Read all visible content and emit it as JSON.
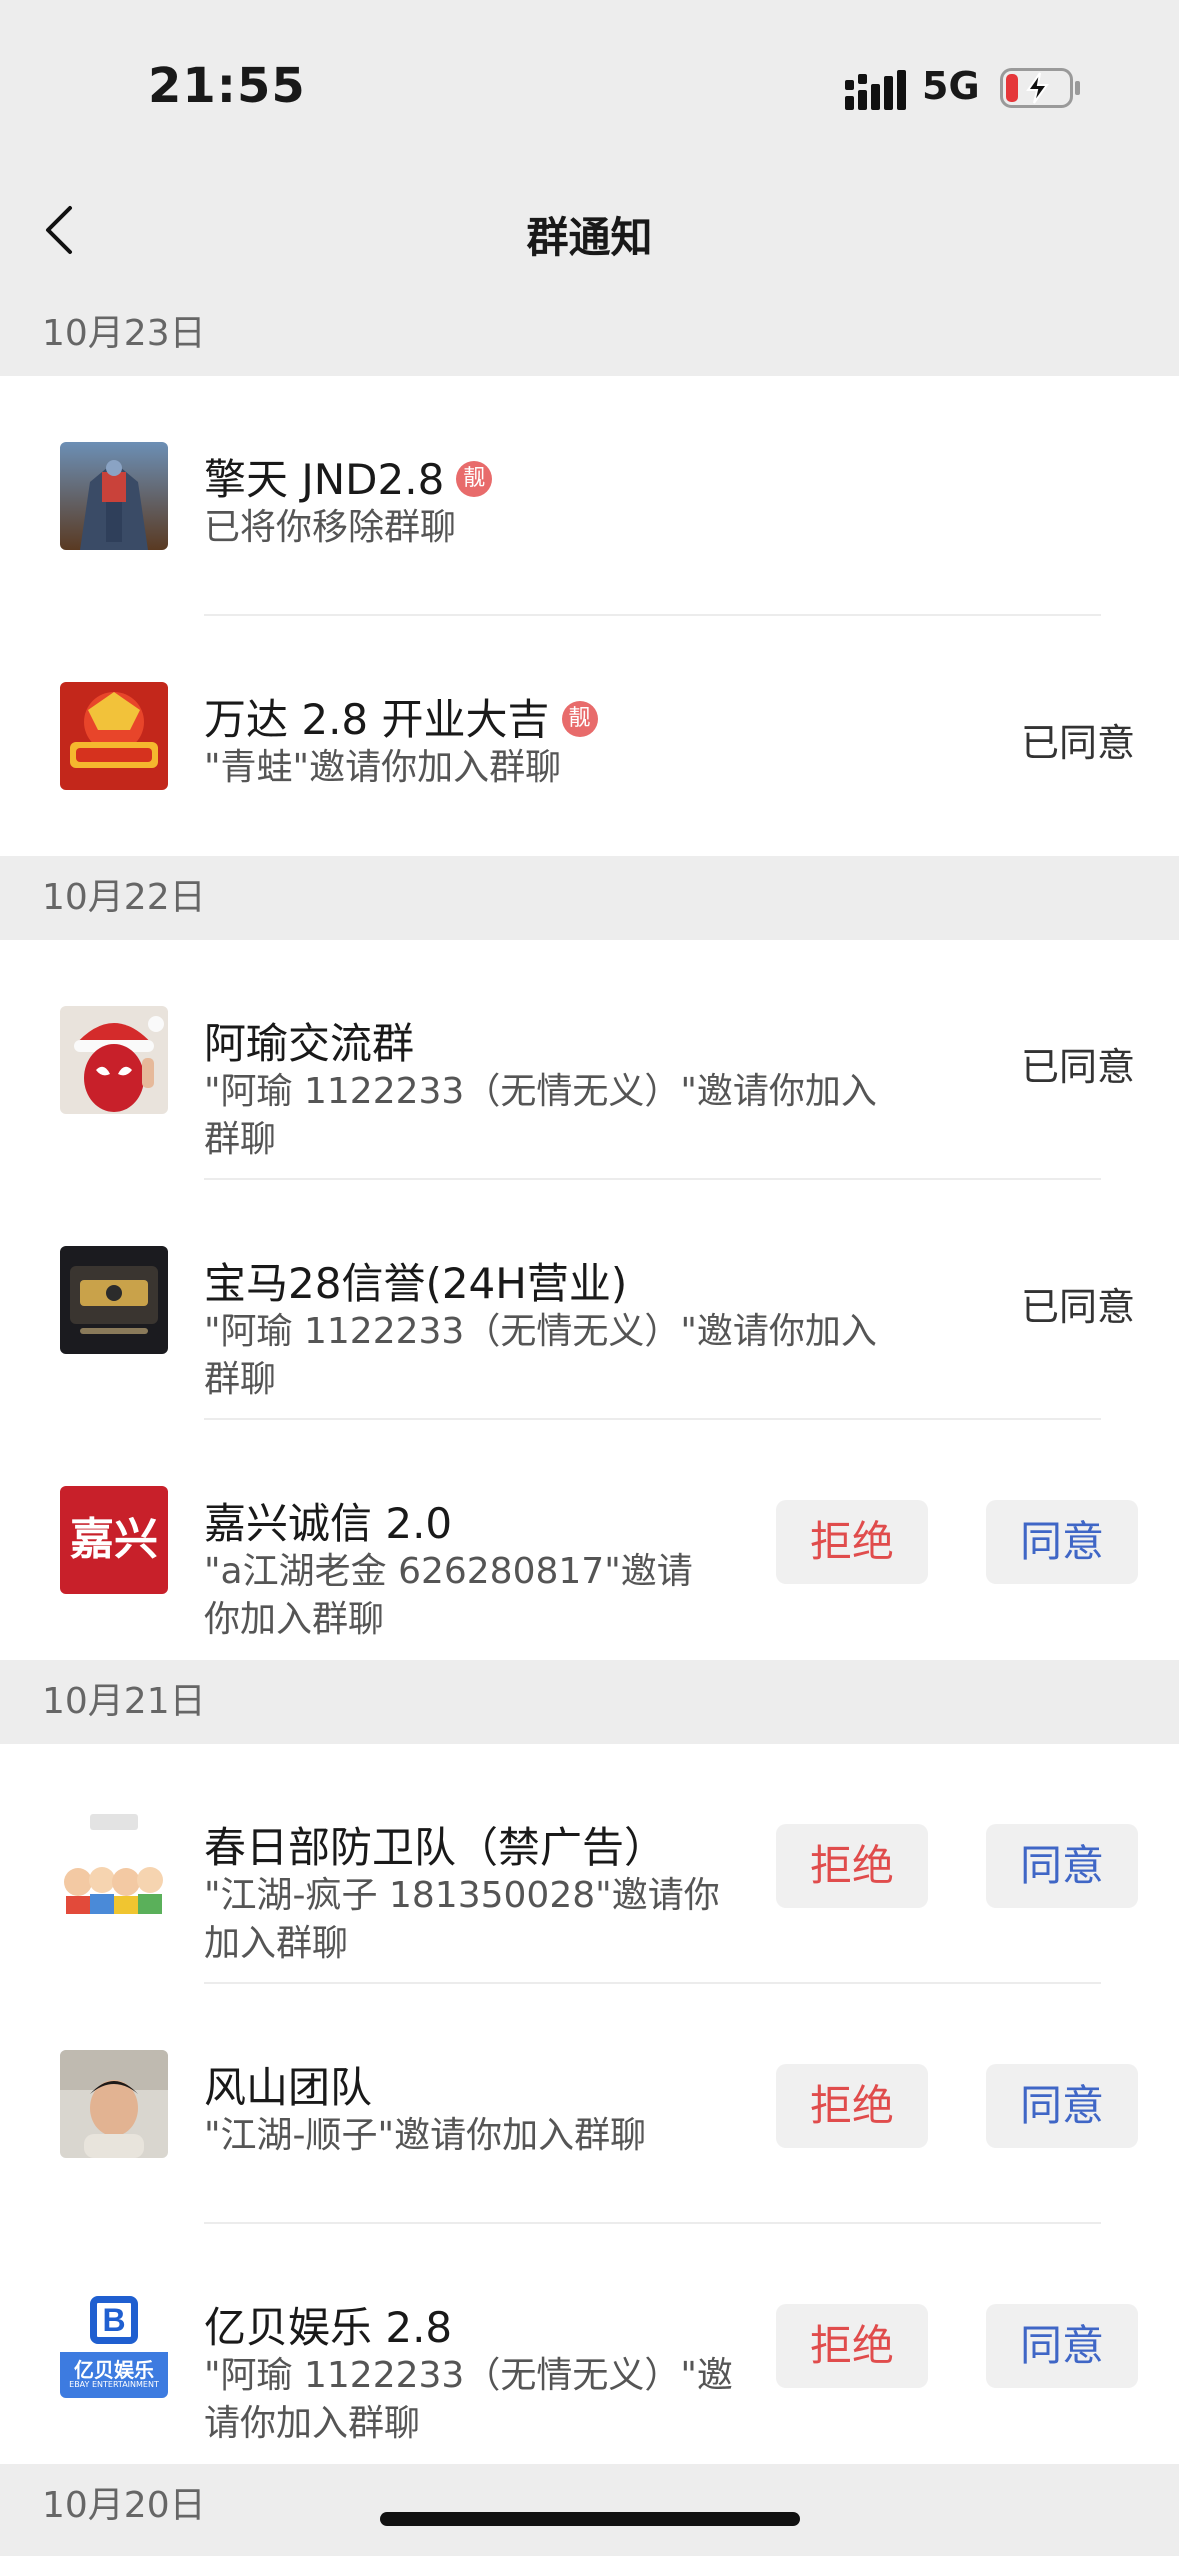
{
  "status_bar": {
    "time": "21:55",
    "network": "5G"
  },
  "nav": {
    "title": "群通知"
  },
  "sections": [
    {
      "date": "10月23日"
    },
    {
      "date": "10月22日"
    },
    {
      "date": "10月21日"
    },
    {
      "date": "10月20日"
    }
  ],
  "items": [
    {
      "name": "擎天 JND2.8",
      "badge": "靓",
      "message": "已将你移除群聊"
    },
    {
      "name": "万达 2.8 开业大吉",
      "badge": "靓",
      "message": "\"青蛙\"邀请你加入群聊",
      "status": "已同意"
    },
    {
      "name": "阿瑜交流群",
      "message_line1": "\"阿瑜 1122233（无情无义）\"邀请你加入",
      "message_line2": "群聊",
      "status": "已同意"
    },
    {
      "name": "宝马28信誉(24H营业)",
      "message_line1": "\"阿瑜 1122233（无情无义）\"邀请你加入",
      "message_line2": "群聊",
      "status": "已同意"
    },
    {
      "name": "嘉兴诚信 2.0",
      "message_line1": "\"a江湖老金 626280817\"邀请",
      "message_line2": "你加入群聊"
    },
    {
      "name": "春日部防卫队（禁广告）",
      "message_line1": "\"江湖-疯子 181350028\"邀请你",
      "message_line2": "加入群聊"
    },
    {
      "name": "风山团队",
      "message": "\"江湖-顺子\"邀请你加入群聊"
    },
    {
      "name": "亿贝娱乐 2.8",
      "message_line1": "\"阿瑜 1122233（无情无义）\"邀",
      "message_line2": "请你加入群聊"
    }
  ],
  "buttons": {
    "reject": "拒绝",
    "accept": "同意"
  },
  "avatar_text": {
    "jiaxing": "嘉兴",
    "yibei_logo": "B",
    "yibei_name": "亿贝娱乐",
    "yibei_sub": "EBAY ENTERTAINMENT"
  },
  "colors": {
    "reject": "#e04c4c",
    "accept": "#3f66c6",
    "badge": "#e86b6b"
  }
}
